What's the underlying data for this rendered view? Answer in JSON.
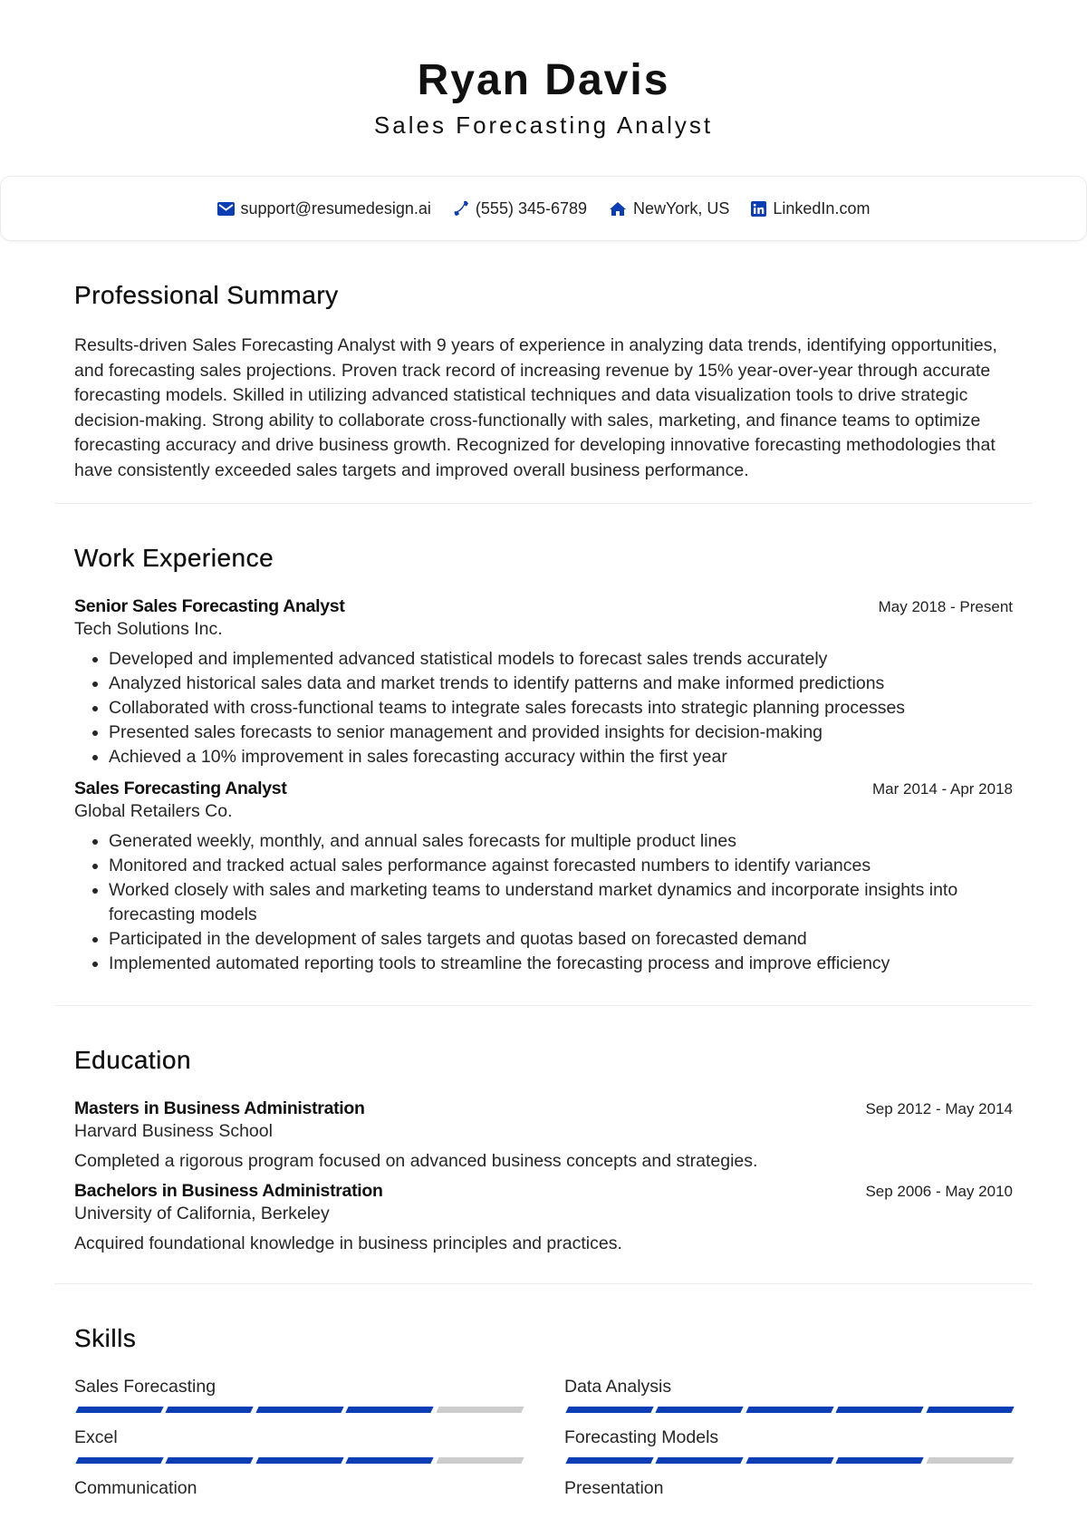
{
  "header": {
    "name": "Ryan Davis",
    "title": "Sales Forecasting Analyst"
  },
  "contact": {
    "accent_color": "#0b3db5",
    "items": [
      {
        "icon": "envelope-icon",
        "text": "support@resumedesign.ai"
      },
      {
        "icon": "phone-icon",
        "text": "(555) 345-6789"
      },
      {
        "icon": "home-icon",
        "text": "NewYork, US"
      },
      {
        "icon": "linkedin-icon",
        "text": "LinkedIn.com"
      }
    ]
  },
  "summary": {
    "heading": "Professional Summary",
    "text": "Results-driven Sales Forecasting Analyst with 9 years of experience in analyzing data trends, identifying opportunities, and forecasting sales projections. Proven track record of increasing revenue by 15% year-over-year through accurate forecasting models. Skilled in utilizing advanced statistical techniques and data visualization tools to drive strategic decision-making. Strong ability to collaborate cross-functionally with sales, marketing, and finance teams to optimize forecasting accuracy and drive business growth. Recognized for developing innovative forecasting methodologies that have consistently exceeded sales targets and improved overall business performance."
  },
  "experience": {
    "heading": "Work Experience",
    "jobs": [
      {
        "role": "Senior Sales Forecasting Analyst",
        "company": "Tech Solutions Inc.",
        "dates": "May 2018 - Present",
        "bullets": [
          "Developed and implemented advanced statistical models to forecast sales trends accurately",
          "Analyzed historical sales data and market trends to identify patterns and make informed predictions",
          "Collaborated with cross-functional teams to integrate sales forecasts into strategic planning processes",
          "Presented sales forecasts to senior management and provided insights for decision-making",
          "Achieved a 10% improvement in sales forecasting accuracy within the first year"
        ]
      },
      {
        "role": "Sales Forecasting Analyst",
        "company": "Global Retailers Co.",
        "dates": "Mar 2014 - Apr 2018",
        "bullets": [
          "Generated weekly, monthly, and annual sales forecasts for multiple product lines",
          "Monitored and tracked actual sales performance against forecasted numbers to identify variances",
          "Worked closely with sales and marketing teams to understand market dynamics and incorporate insights into forecasting models",
          "Participated in the development of sales targets and quotas based on forecasted demand",
          "Implemented automated reporting tools to streamline the forecasting process and improve efficiency"
        ]
      }
    ]
  },
  "education": {
    "heading": "Education",
    "entries": [
      {
        "degree": "Masters in Business Administration",
        "school": "Harvard Business School",
        "dates": "Sep 2012 - May 2014",
        "description": "Completed a rigorous program focused on advanced business concepts and strategies."
      },
      {
        "degree": "Bachelors in Business Administration",
        "school": "University of California, Berkeley",
        "dates": "Sep 2006 - May 2010",
        "description": "Acquired foundational knowledge in business principles and practices."
      }
    ]
  },
  "skills": {
    "heading": "Skills",
    "max_level": 5,
    "filled_color": "#0b3db5",
    "empty_color": "#cccccc",
    "items": [
      {
        "name": "Sales Forecasting",
        "level": 4
      },
      {
        "name": "Data Analysis",
        "level": 5
      },
      {
        "name": "Excel",
        "level": 4
      },
      {
        "name": "Forecasting Models",
        "level": 4
      },
      {
        "name": "Communication",
        "level": null
      },
      {
        "name": "Presentation",
        "level": null
      }
    ]
  }
}
